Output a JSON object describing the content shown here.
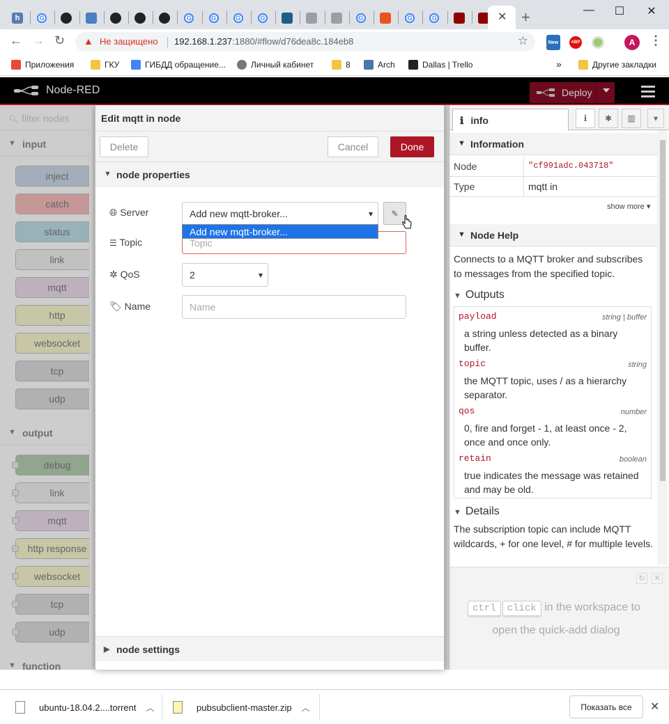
{
  "browser": {
    "tabs": [
      {
        "icon": "h-icon",
        "letter": "h",
        "color": "#5b7ab0"
      },
      {
        "icon": "google-icon",
        "letter": "G",
        "color": "#4285f4"
      },
      {
        "icon": "github-icon",
        "letter": "",
        "color": "#222222"
      },
      {
        "icon": "globe-icon",
        "letter": "",
        "color": "#4a7fc1"
      },
      {
        "icon": "github-icon",
        "letter": "",
        "color": "#222222"
      },
      {
        "icon": "github-icon",
        "letter": "",
        "color": "#222222"
      },
      {
        "icon": "github-icon",
        "letter": "",
        "color": "#222222"
      },
      {
        "icon": "google-icon",
        "letter": "G",
        "color": "#4285f4"
      },
      {
        "icon": "google-icon",
        "letter": "G",
        "color": "#4285f4"
      },
      {
        "icon": "google-icon",
        "letter": "G",
        "color": "#4285f4"
      },
      {
        "icon": "google-icon",
        "letter": "G",
        "color": "#4285f4"
      },
      {
        "icon": "arch-icon",
        "letter": "",
        "color": "#1b5e8a"
      },
      {
        "icon": "page-icon",
        "letter": "",
        "color": "#9aa0a6"
      },
      {
        "icon": "page-icon",
        "letter": "",
        "color": "#9aa0a6"
      },
      {
        "icon": "google-icon",
        "letter": "G",
        "color": "#4285f4"
      },
      {
        "icon": "ubuntu-icon",
        "letter": "",
        "color": "#e95420"
      },
      {
        "icon": "google-icon",
        "letter": "G",
        "color": "#4285f4"
      },
      {
        "icon": "google-icon",
        "letter": "G",
        "color": "#4285f4"
      },
      {
        "icon": "nodered-icon",
        "letter": "",
        "color": "#8f0000"
      },
      {
        "icon": "nodered-icon",
        "letter": "",
        "color": "#8f0000"
      }
    ],
    "address": {
      "security_text": "Не защищено",
      "url_host": "192.168.1.237",
      "url_rest": ":1880/#flow/d76dea8c.184eb8"
    },
    "extensions": {
      "new_badge": "New",
      "abp": "ABP",
      "avatar_letter": "A"
    },
    "bookmarks": [
      {
        "label": "Приложения",
        "icon": "apps-icon",
        "color": "#e84a3b"
      },
      {
        "label": "ГКУ",
        "icon": "folder-icon",
        "color": "#f4c542"
      },
      {
        "label": "ГИБДД обращение...",
        "icon": "docs-icon",
        "color": "#4285f4"
      },
      {
        "label": "Личный кабинет",
        "icon": "car-icon",
        "color": "#777777"
      },
      {
        "label": "8",
        "icon": "folder-icon",
        "color": "#f4c542"
      },
      {
        "label": "Arch",
        "icon": "vk-icon",
        "color": "#4a76a8"
      },
      {
        "label": "Dallas | Trello",
        "icon": "trello-icon",
        "color": "#222222"
      },
      {
        "label": "Другие закладки",
        "icon": "folder-icon",
        "color": "#f4c542"
      }
    ],
    "more_chevron": "»"
  },
  "app": {
    "title": "Node-RED",
    "deploy_label": "Deploy"
  },
  "palette": {
    "filter_placeholder": "filter nodes",
    "categories": {
      "input": "input",
      "output": "output",
      "function": "function"
    },
    "input_nodes": [
      {
        "label": "inject",
        "color": "#a6bbcf"
      },
      {
        "label": "catch",
        "color": "#e49191"
      },
      {
        "label": "status",
        "color": "#94c1d0"
      },
      {
        "label": "link",
        "color": "#dddddd"
      },
      {
        "label": "mqtt",
        "color": "#d8bfd8"
      },
      {
        "label": "http",
        "color": "#e7e7ae"
      },
      {
        "label": "websocket",
        "color": "#e7e7ae"
      },
      {
        "label": "tcp",
        "color": "#c0c0c0"
      },
      {
        "label": "udp",
        "color": "#c0c0c0"
      }
    ],
    "output_nodes": [
      {
        "label": "debug",
        "color": "#87a980"
      },
      {
        "label": "link",
        "color": "#dddddd"
      },
      {
        "label": "mqtt",
        "color": "#d8bfd8"
      },
      {
        "label": "http response",
        "color": "#e7e7ae"
      },
      {
        "label": "websocket",
        "color": "#e7e7ae"
      },
      {
        "label": "tcp",
        "color": "#c0c0c0"
      },
      {
        "label": "udp",
        "color": "#c0c0c0"
      }
    ]
  },
  "editor": {
    "title": "Edit mqtt in node",
    "delete_label": "Delete",
    "cancel_label": "Cancel",
    "done_label": "Done",
    "properties_section": "node properties",
    "settings_section": "node settings",
    "server_label": "Server",
    "server_value": "Add new mqtt-broker...",
    "server_option": "Add new mqtt-broker...",
    "topic_label": "Topic",
    "topic_placeholder": "Topic",
    "qos_label": "QoS",
    "qos_value": "2",
    "name_label": "Name",
    "name_placeholder": "Name"
  },
  "sidebar": {
    "tab_label": "info",
    "info_section": "Information",
    "node_key": "Node",
    "node_value": "\"cf991adc.043718\"",
    "type_key": "Type",
    "type_value": "mqtt in",
    "show_more": "show more",
    "help_section": "Node Help",
    "help_intro": "Connects to a MQTT broker and subscribes to messages from the specified topic.",
    "outputs_heading": "Outputs",
    "outputs": [
      {
        "key": "payload",
        "type": "string | buffer",
        "desc": "a string unless detected as a binary buffer."
      },
      {
        "key": "topic",
        "type": "string",
        "desc": "the MQTT topic, uses / as a hierarchy separator."
      },
      {
        "key": "qos",
        "type": "number",
        "desc": "0, fire and forget - 1, at least once - 2, once and once only."
      },
      {
        "key": "retain",
        "type": "boolean",
        "desc": "true indicates the message was retained and may be old."
      }
    ],
    "details_heading": "Details",
    "details_text": "The subscription topic can include MQTT wildcards, + for one level, # for multiple levels.",
    "quickadd_ctrl": "ctrl",
    "quickadd_click": "click",
    "quickadd_line1": "in the workspace to",
    "quickadd_line2": "open the quick-add dialog"
  },
  "downloads": {
    "items": [
      {
        "name": "ubuntu-18.04.2....torrent"
      },
      {
        "name": "pubsubclient-master.zip"
      }
    ],
    "show_all": "Показать все"
  }
}
